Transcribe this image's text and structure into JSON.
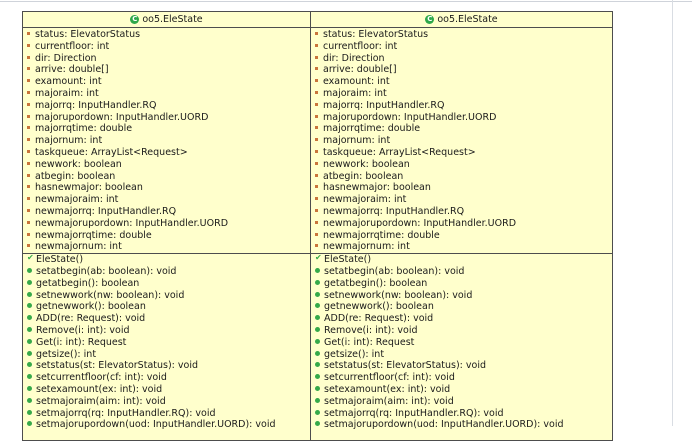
{
  "classes": [
    {
      "name": "oo5.EleState",
      "fields": [
        "status: ElevatorStatus",
        "currentfloor: int",
        "dir: Direction",
        "arrive: double[]",
        "examount: int",
        "majoraim: int",
        "majorrq: InputHandler.RQ",
        "majorupordown: InputHandler.UORD",
        "majorrqtime: double",
        "majornum: int",
        "taskqueue: ArrayList<Request>",
        "newwork: boolean",
        "atbegin: boolean",
        "hasnewmajor: boolean",
        "newmajoraim: int",
        "newmajorrq: InputHandler.RQ",
        "newmajorupordown: InputHandler.UORD",
        "newmajorrqtime: double",
        "newmajornum: int"
      ],
      "constructor": "EleState()",
      "methods": [
        "setatbegin(ab: boolean): void",
        "getatbegin(): boolean",
        "setnewwork(nw: boolean): void",
        "getnewwork(): boolean",
        "ADD(re: Request): void",
        "Remove(i: int): void",
        "Get(i: int): Request",
        "getsize(): int",
        "setstatus(st: ElevatorStatus): void",
        "setcurrentfloor(cf: int): void",
        "setexamount(ex: int): void",
        "setmajoraim(aim: int): void",
        "setmajorrq(rq: InputHandler.RQ): void",
        "setmajorupordown(uod: InputHandler.UORD): void"
      ]
    },
    {
      "name": "oo5.EleState",
      "fields": [
        "status: ElevatorStatus",
        "currentfloor: int",
        "dir: Direction",
        "arrive: double[]",
        "examount: int",
        "majoraim: int",
        "majorrq: InputHandler.RQ",
        "majorupordown: InputHandler.UORD",
        "majorrqtime: double",
        "majornum: int",
        "taskqueue: ArrayList<Request>",
        "newwork: boolean",
        "atbegin: boolean",
        "hasnewmajor: boolean",
        "newmajoraim: int",
        "newmajorrq: InputHandler.RQ",
        "newmajorupordown: InputHandler.UORD",
        "newmajorrqtime: double",
        "newmajornum: int"
      ],
      "constructor": "EleState()",
      "methods": [
        "setatbegin(ab: boolean): void",
        "getatbegin(): boolean",
        "setnewwork(nw: boolean): void",
        "getnewwork(): boolean",
        "ADD(re: Request): void",
        "Remove(i: int): void",
        "Get(i: int): Request",
        "getsize(): int",
        "setstatus(st: ElevatorStatus): void",
        "setcurrentfloor(cf: int): void",
        "setexamount(ex: int): void",
        "setmajoraim(aim: int): void",
        "setmajorrq(rq: InputHandler.RQ): void",
        "setmajorupordown(uod: InputHandler.UORD): void"
      ]
    }
  ],
  "colors": {
    "class_fill": "#ffffcc",
    "border": "#4d4d4d",
    "field_icon": "#c9743b",
    "method_icon": "#36a94a"
  }
}
